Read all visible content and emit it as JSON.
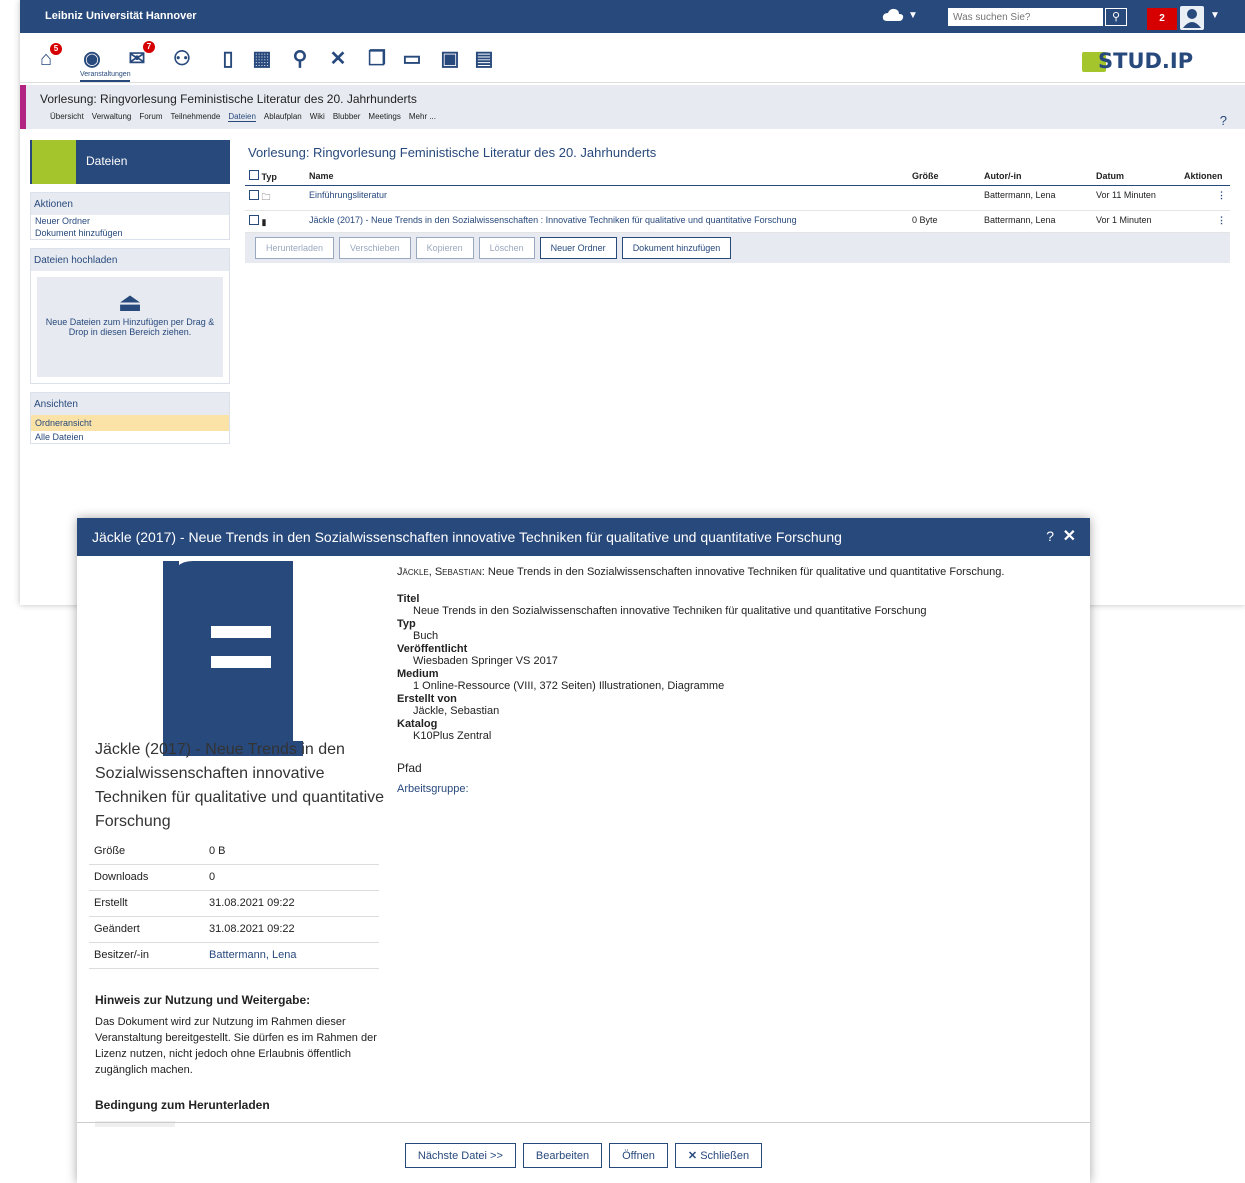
{
  "topbar": {
    "university": "Leibniz Universität Hannover",
    "search_placeholder": "Was suchen Sie?",
    "notifications": "2"
  },
  "nav": {
    "icons": [
      "home-icon",
      "courses-icon",
      "messages-icon",
      "community-icon",
      "profile-icon",
      "calendar-icon",
      "search-icon",
      "tools-icon",
      "files-icon",
      "contents-icon",
      "schedule-icon",
      "resources-icon"
    ],
    "badge_home": "5",
    "badge_messages": "7",
    "active_label": "Veranstaltungen",
    "logo_text": "STUD.IP"
  },
  "context": {
    "title": "Vorlesung: Ringvorlesung Feministische Literatur des 20. Jahrhunderts",
    "tabs": [
      "Übersicht",
      "Verwaltung",
      "Forum",
      "Teilnehmende",
      "Dateien",
      "Ablaufplan",
      "Wiki",
      "Blubber",
      "Meetings",
      "Mehr ..."
    ]
  },
  "sidebar": {
    "head": "Dateien",
    "actions_title": "Aktionen",
    "action_new_folder": "Neuer Ordner",
    "action_add_doc": "Dokument hinzufügen",
    "upload_title": "Dateien hochladen",
    "upload_text": "Neue Dateien zum Hinzufügen per Drag & Drop in diesen Bereich ziehen.",
    "views_title": "Ansichten",
    "view_folder": "Ordneransicht",
    "view_all": "Alle Dateien"
  },
  "main": {
    "title": "Vorlesung: Ringvorlesung Feministische Literatur des 20. Jahrhunderts",
    "columns": {
      "typ": "Typ",
      "name": "Name",
      "size": "Größe",
      "author": "Autor/-in",
      "date": "Datum",
      "actions": "Aktionen"
    },
    "rows": [
      {
        "name": "Einführungsliteratur",
        "size": "",
        "author": "Battermann, Lena",
        "date": "Vor 11 Minuten"
      },
      {
        "name": "Jäckle (2017) - Neue Trends in den Sozialwissenschaften : Innovative Techniken für qualitative und quantitative Forschung",
        "size": "0 Byte",
        "author": "Battermann, Lena",
        "date": "Vor 1 Minuten"
      }
    ],
    "buttons": {
      "download": "Herunterladen",
      "move": "Verschieben",
      "copy": "Kopieren",
      "delete": "Löschen",
      "new_folder": "Neuer Ordner",
      "add_doc": "Dokument hinzufügen"
    }
  },
  "dialog": {
    "title": "Jäckle (2017) - Neue Trends in den Sozialwissenschaften innovative Techniken für qualitative und quantitative Forschung",
    "big_title": "Jäckle (2017) - Neue Trends in den Sozialwissenschaften innovative Techniken für qualitative und quantitative Forschung",
    "info": [
      {
        "k": "Größe",
        "v": "0 B"
      },
      {
        "k": "Downloads",
        "v": "0"
      },
      {
        "k": "Erstellt",
        "v": "31.08.2021 09:22"
      },
      {
        "k": "Geändert",
        "v": "31.08.2021 09:22"
      },
      {
        "k": "Besitzer/-in",
        "v": "Battermann, Lena"
      }
    ],
    "hint_title": "Hinweis zur Nutzung und Weitergabe:",
    "hint_text": "Das Dokument wird zur Nutzung im Rahmen dieser Veranstaltung bereitgestellt. Sie dürfen es im Rahmen der Lizenz nutzen, nicht jedoch ohne Erlaubnis öffentlich zugänglich machen.",
    "cond_title": "Bedingung zum Herunterladen",
    "citation_author": "Jäckle, Sebastian:",
    "citation_text": "Neue Trends in den Sozialwissenschaften innovative Techniken für qualitative und quantitative Forschung.",
    "fields": [
      {
        "k": "Titel",
        "v": "Neue Trends in den Sozialwissenschaften innovative Techniken für qualitative und quantitative Forschung"
      },
      {
        "k": "Typ",
        "v": "Buch"
      },
      {
        "k": "Veröffentlicht",
        "v": "Wiesbaden Springer VS 2017"
      },
      {
        "k": "Medium",
        "v": "1 Online-Ressource (VIII, 372 Seiten) Illustrationen, Diagramme"
      },
      {
        "k": "Erstellt von",
        "v": "Jäckle, Sebastian"
      },
      {
        "k": "Katalog",
        "v": "K10Plus Zentral"
      }
    ],
    "pfad_label": "Pfad",
    "pfad_value": "Arbeitsgruppe:",
    "buttons": {
      "next": "Nächste Datei >>",
      "edit": "Bearbeiten",
      "open": "Öffnen",
      "close": "Schließen"
    }
  }
}
